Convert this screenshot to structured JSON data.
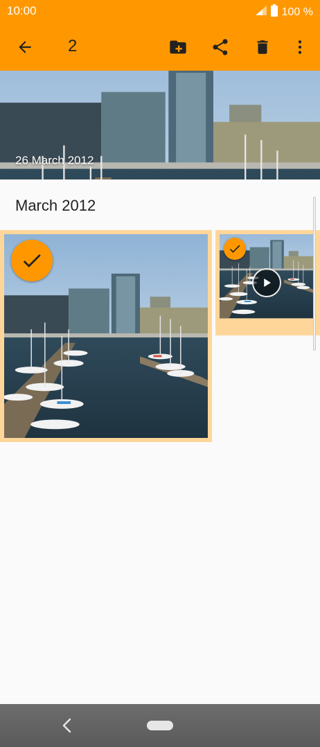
{
  "status_bar": {
    "time": "10:00",
    "battery_text": "100 %",
    "icons": [
      "signal-icon",
      "battery-icon"
    ]
  },
  "app_bar": {
    "selected_count": "2",
    "actions": [
      "back-arrow-icon",
      "move-to-folder-icon",
      "share-icon",
      "delete-icon",
      "more-vert-icon"
    ]
  },
  "header": {
    "date_label": "26 March 2012"
  },
  "gallery": {
    "section_title": "March 2012",
    "items": [
      {
        "type": "photo",
        "selected": true
      },
      {
        "type": "video",
        "selected": true
      }
    ]
  },
  "nav_bar": {
    "icons": [
      "nav-back-icon",
      "nav-home-pill"
    ]
  },
  "colors": {
    "accent": "#ff9800",
    "selection_border": "#ffd699",
    "background": "#fafafa"
  }
}
